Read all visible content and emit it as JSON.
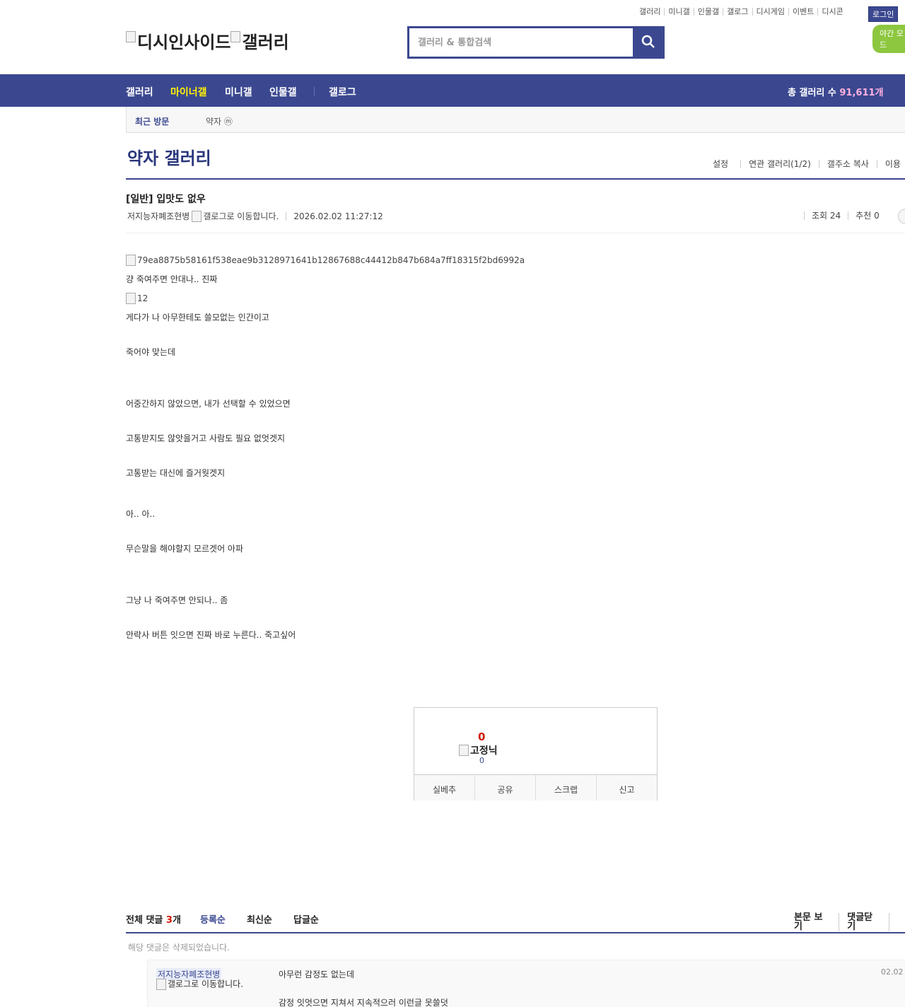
{
  "top_nav": {
    "links": [
      "갤러리",
      "미니갤",
      "인물갤",
      "갤로그",
      "디시게임",
      "이벤트",
      "디시콘"
    ],
    "login": "로그인",
    "night_mode": "야간 모드"
  },
  "logo": {
    "site": "디시인사이드",
    "gallery": "갤러리"
  },
  "search": {
    "placeholder": "갤러리 & 통합검색"
  },
  "gnb": {
    "items": [
      "갤러리",
      "마이너갤",
      "미니갤",
      "인물갤",
      "갤로그"
    ],
    "active": "마이너갤",
    "total_label": "총 갤러리 수",
    "total_count": "91,611개"
  },
  "visit": {
    "label": "최근 방문",
    "entry": "약자 ⓜ"
  },
  "gallery": {
    "title": "약자 갤러리",
    "tools": [
      "설정",
      "연관 갤러리(1/2)",
      "갤주소 복사",
      "이용"
    ]
  },
  "post": {
    "title": "[일반] 입맛도 없우",
    "author": "저지능자폐조현병",
    "gallog_alt": "갤로그로 이동합니다.",
    "date": "2026.02.02 11:27:12",
    "views": "조회 24",
    "recommend": "추천 0",
    "image1_alt": "79ea8875b58161f538eae9b3128971641b12867688c44412b847b684a7ff18315f2bd6992a",
    "image2_alt": "12",
    "lines": [
      "걍 죽여주면 안대나.. 진짜",
      "게다가 나 아무한테도 쓸모없는 인간이고",
      "죽어야 맞는데",
      "어중간하지 않았으면, 내가 선택할 수 있었으면",
      "고통받지도 않앗을거고 사람도 필요 없엇겟지",
      "고통받는 대신에 즐거웟겟지",
      "아.. 아..",
      "무슨말을 해야할지 모르겟어 아파",
      "그냥 나 죽여주면 안되나.. 좀",
      "안락사 버튼 잇으면 진짜 바로 누른다.. 죽고싶어"
    ]
  },
  "recommend_box": {
    "count": "0",
    "fix_label": "고정닉",
    "fix_count": "0",
    "buttons": [
      "실베추",
      "공유",
      "스크랩",
      "신고"
    ]
  },
  "comments": {
    "label": "전체 댓글",
    "count": "3",
    "unit": "개",
    "sort": [
      "등록순",
      "최신순",
      "답글순"
    ],
    "right": [
      "본문 보기",
      "댓글닫기"
    ],
    "deleted": "해당 댓글은 삭제되었습니다.",
    "reply": {
      "nick": "저지능자폐조현병",
      "gallog_alt": "갤로그로 이동합니다.",
      "text1": "아무런 감정도 없는데",
      "text2": "감정 잇엇으면 지쳐서 지속적으러 이런글 못쓸덧",
      "date": "02.02"
    }
  }
}
